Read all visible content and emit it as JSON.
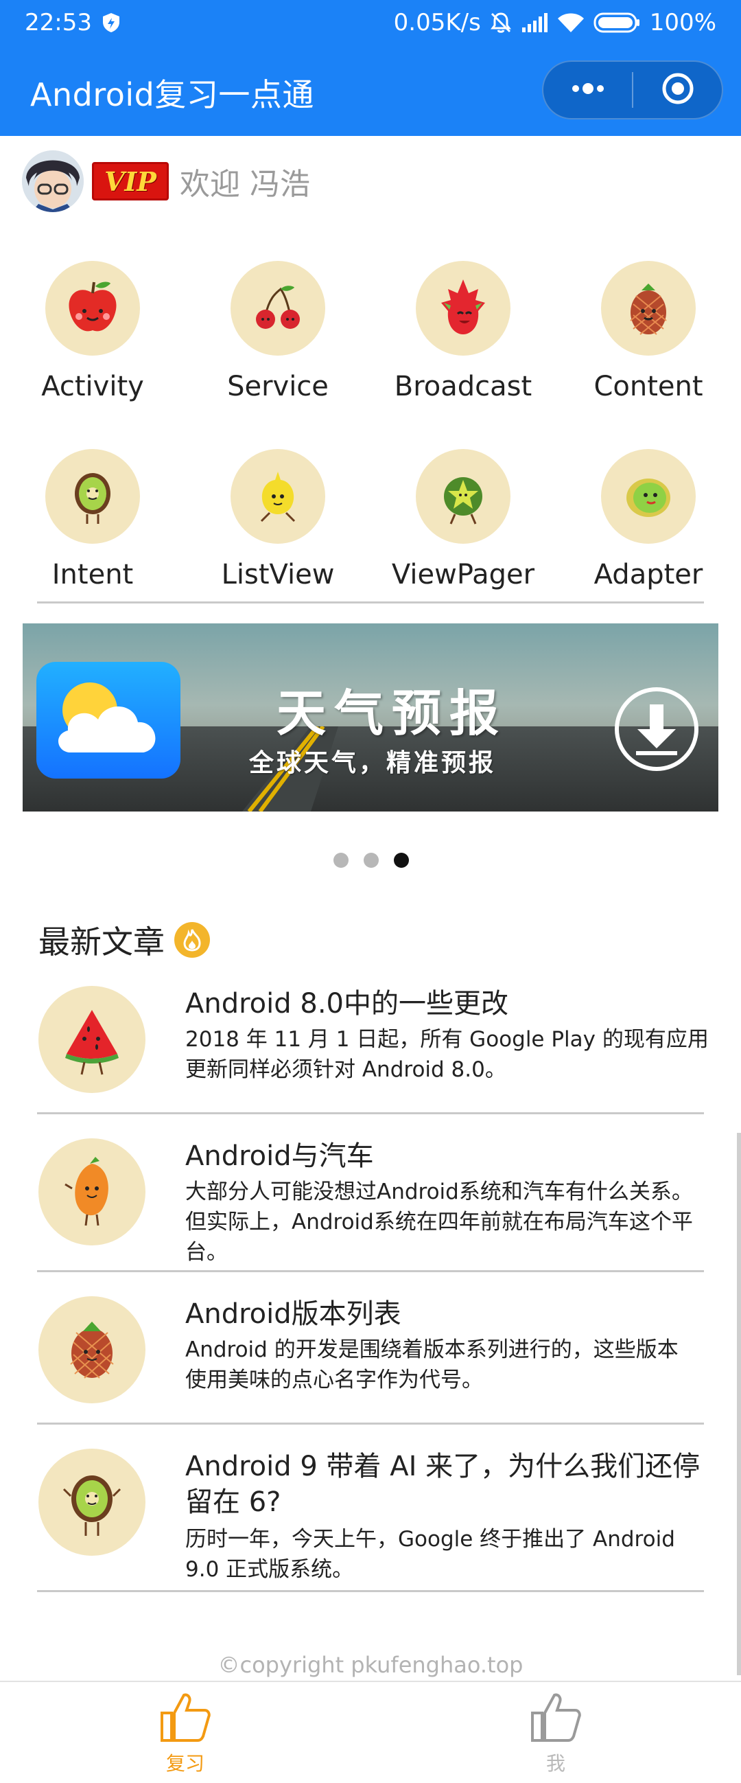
{
  "status_bar": {
    "time": "22:53",
    "network_speed": "0.05K/s",
    "battery": "100%",
    "icons": [
      "shield-icon",
      "mute-bell-icon",
      "signal-icon",
      "wifi-icon",
      "battery-icon"
    ]
  },
  "header": {
    "title": "Android复习一点通",
    "capsule_icons": [
      "more-icon",
      "close-target-icon"
    ],
    "background": "#1b82f7"
  },
  "user": {
    "vip_label": "VIP",
    "welcome": "欢迎 冯浩"
  },
  "grid": [
    {
      "label": "Activity",
      "icon": "apple-icon"
    },
    {
      "label": "Service",
      "icon": "cherry-icon"
    },
    {
      "label": "Broadcast",
      "icon": "dragonfruit-icon"
    },
    {
      "label": "Content",
      "icon": "pineapple-icon"
    },
    {
      "label": "Intent",
      "icon": "kiwi-icon"
    },
    {
      "label": "ListView",
      "icon": "lemon-icon"
    },
    {
      "label": "ViewPager",
      "icon": "starfruit-icon"
    },
    {
      "label": "Adapter",
      "icon": "lime-icon"
    }
  ],
  "banner": {
    "title": "天气预报",
    "subtitle": "全球天气，精准预报",
    "dots": 3,
    "active_dot": 2
  },
  "section": {
    "title": "最新文章"
  },
  "articles": [
    {
      "title": "Android 8.0中的一些更改",
      "desc_lines": [
        "2018 年 11 月 1 日起，所有 Google Play 的现有应用",
        "更新同样必须针对 Android 8.0。"
      ],
      "icon": "watermelon-icon"
    },
    {
      "title": "Android与汽车",
      "desc_lines": [
        "大部分人可能没想过Android系统和汽车有什么关系。",
        "但实际上，Android系统在四年前就在布局汽车这个平",
        "台。"
      ],
      "icon": "mango-icon"
    },
    {
      "title": "Android版本列表",
      "desc_lines": [
        "Android 的开发是围绕着版本系列进行的，这些版本",
        "使用美味的点心名字作为代号。"
      ],
      "icon": "strawberry-icon"
    },
    {
      "title_lines": [
        "Android 9 带着 AI 来了，为什么我们还停",
        "留在 6?"
      ],
      "desc_lines": [
        "历时一年，今天上午，Google 终于推出了 Android",
        "9.0 正式版系统。"
      ],
      "icon": "kiwi-icon"
    }
  ],
  "footer": {
    "copyright": "©copyright pkufenghao.top"
  },
  "tabbar": {
    "tabs": [
      {
        "label": "复习",
        "icon": "thumbs-up-icon",
        "active": true
      },
      {
        "label": "我",
        "icon": "thumbs-up-icon",
        "active": false
      }
    ],
    "active_color": "#f39a12"
  }
}
